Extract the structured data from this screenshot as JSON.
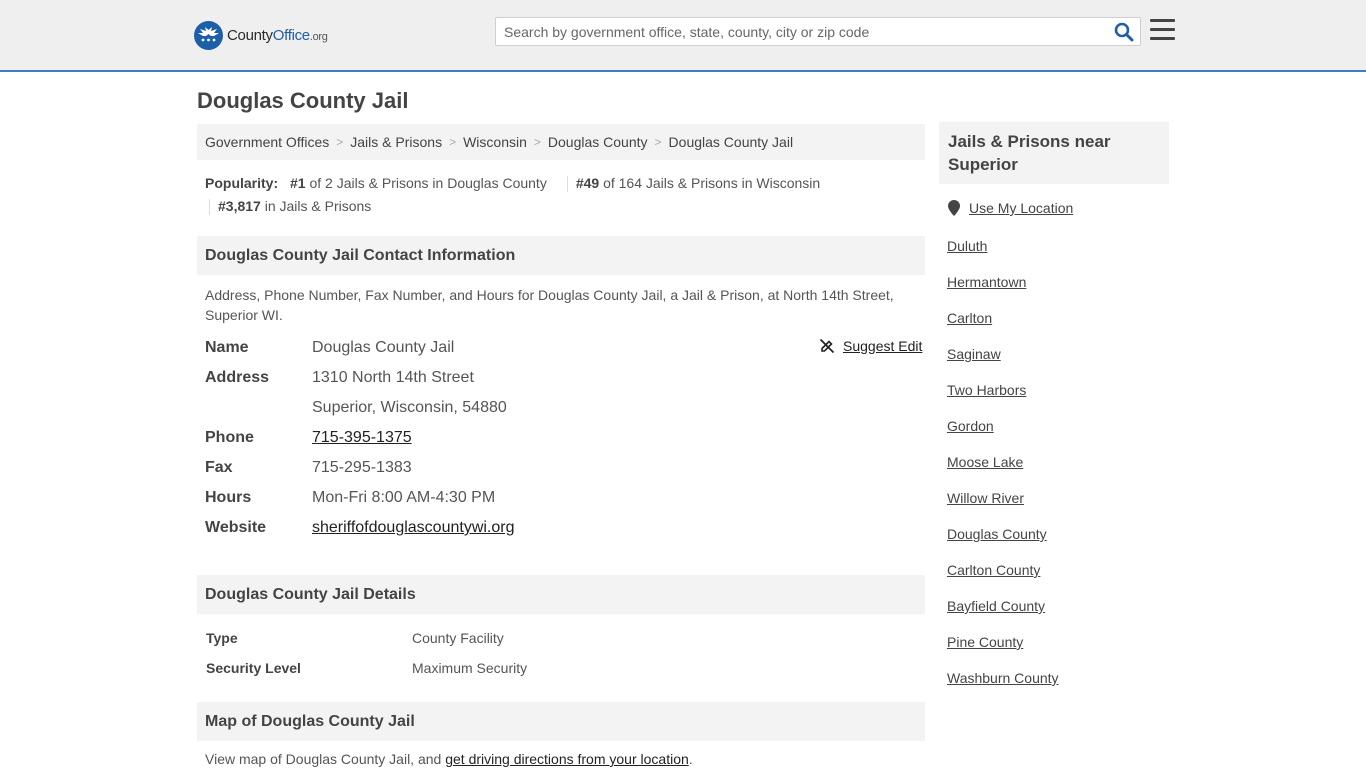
{
  "header": {
    "logo": {
      "part1": "County",
      "part2": "Office",
      "part3": ".org"
    },
    "search_placeholder": "Search by government office, state, county, city or zip code",
    "icons": {
      "search": "search-icon",
      "menu": "hamburger-menu-icon"
    },
    "colors": {
      "accent": "#3b7fc4",
      "brand": "#1c5fa8"
    }
  },
  "page": {
    "title": "Douglas County Jail"
  },
  "breadcrumb": [
    "Government Offices",
    "Jails & Prisons",
    "Wisconsin",
    "Douglas County",
    "Douglas County Jail"
  ],
  "popularity": {
    "label": "Popularity:",
    "items": [
      {
        "rank": "#1",
        "text": "of 2 Jails & Prisons in Douglas County"
      },
      {
        "rank": "#49",
        "text": "of 164 Jails & Prisons in Wisconsin"
      },
      {
        "rank": "#3,817",
        "text": "in Jails & Prisons"
      }
    ]
  },
  "contact": {
    "heading": "Douglas County Jail Contact Information",
    "description": "Address, Phone Number, Fax Number, and Hours for Douglas County Jail, a Jail & Prison, at North 14th Street, Superior WI.",
    "suggest_edit": "Suggest Edit",
    "rows": {
      "name": {
        "label": "Name",
        "value": "Douglas County Jail"
      },
      "address": {
        "label": "Address",
        "line1": "1310 North 14th Street",
        "line2": "Superior, Wisconsin, 54880"
      },
      "phone": {
        "label": "Phone",
        "value": "715-395-1375"
      },
      "fax": {
        "label": "Fax",
        "value": "715-295-1383"
      },
      "hours": {
        "label": "Hours",
        "value": "Mon-Fri 8:00 AM-4:30 PM"
      },
      "website": {
        "label": "Website",
        "value": "sheriffofdouglascountywi.org"
      }
    }
  },
  "details": {
    "heading": "Douglas County Jail Details",
    "type": {
      "label": "Type",
      "value": "County Facility"
    },
    "security": {
      "label": "Security Level",
      "value": "Maximum Security"
    }
  },
  "map": {
    "heading": "Map of Douglas County Jail",
    "text_before": "View map of Douglas County Jail, and ",
    "link": "get driving directions from your location",
    "text_after": "."
  },
  "sidebar": {
    "heading": "Jails & Prisons near Superior",
    "use_location": "Use My Location",
    "links": [
      "Duluth",
      "Hermantown",
      "Carlton",
      "Saginaw",
      "Two Harbors",
      "Gordon",
      "Moose Lake",
      "Willow River",
      "Douglas County",
      "Carlton County",
      "Bayfield County",
      "Pine County",
      "Washburn County"
    ]
  }
}
